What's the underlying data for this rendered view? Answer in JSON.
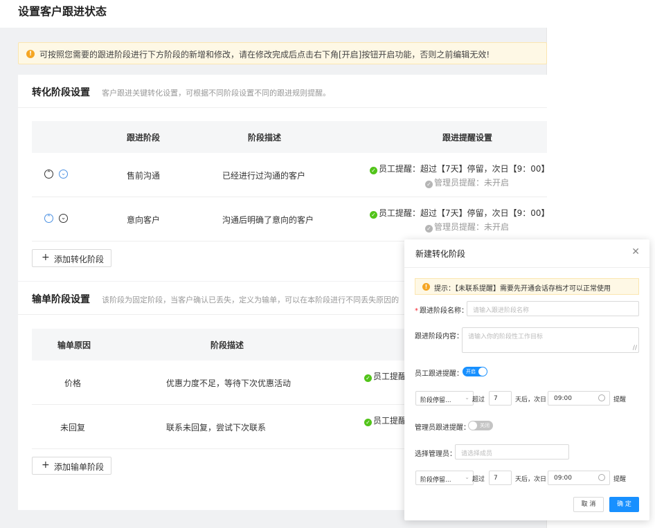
{
  "page": {
    "title": "设置客户跟进状态",
    "notice": "可按照您需要的跟进阶段进行下方阶段的新增和修改，请在修改完成后点击右下角[开启]按钮开启功能，否则之前编辑无效!"
  },
  "conversion": {
    "heading": "转化阶段设置",
    "description": "客户跟进关键转化设置，可根据不同阶段设置不同的跟进规则提醒。",
    "columns": [
      "跟进阶段",
      "阶段描述",
      "跟进提醒设置"
    ],
    "rows": [
      {
        "stage": "售前沟通",
        "desc": "已经进行过沟通的客户",
        "staff_reminder": "员工提醒：超过【7天】停留，次日【9：00】",
        "admin_reminder": "管理员提醒：未开启"
      },
      {
        "stage": "意向客户",
        "desc": "沟通后明确了意向的客户",
        "staff_reminder": "员工提醒：超过【7天】停留，次日【9：00】",
        "admin_reminder": "管理员提醒：未开启"
      }
    ],
    "add_label": "添加转化阶段"
  },
  "loss": {
    "heading": "输单阶段设置",
    "description": "该阶段为固定阶段，当客户确认已丢失，定义为输单，可以在本阶段进行不同丢失原因的",
    "columns": [
      "输单原因",
      "阶段描述"
    ],
    "rows": [
      {
        "reason": "价格",
        "desc": "优惠力度不足，等待下次优惠活动",
        "staff_reminder": "员工提醒"
      },
      {
        "reason": "未回复",
        "desc": "联系未回复，尝试下次联系",
        "staff_reminder": "员工提醒"
      }
    ],
    "add_label": "添加输单阶段"
  },
  "modal": {
    "title": "新建转化阶段",
    "tip": "提示：【未联系提醒】需要先开通会话存档才可以正常使用",
    "name_label": "跟进阶段名称：",
    "name_placeholder": "请输入跟进阶段名称",
    "content_label": "跟进阶段内容：",
    "content_placeholder": "请输入你的阶段性工作目标",
    "staff_label": "员工跟进提醒：",
    "staff_toggle": "开启",
    "admin_label": "管理员跟进提醒：",
    "admin_toggle": "关闭",
    "select_admin_label": "选择管理员：",
    "select_admin_placeholder": "请选择成员",
    "rule1": {
      "select": "阶段停留...",
      "over": "超过",
      "days": "7",
      "after": "天后，次日",
      "time": "09:00",
      "remind": "提醒"
    },
    "rule2": {
      "select": "阶段停留...",
      "over": "超过",
      "days": "7",
      "after": "天后，次日",
      "time": "09:00",
      "remind": "提醒"
    },
    "cancel": "取 消",
    "confirm": "确 定"
  }
}
